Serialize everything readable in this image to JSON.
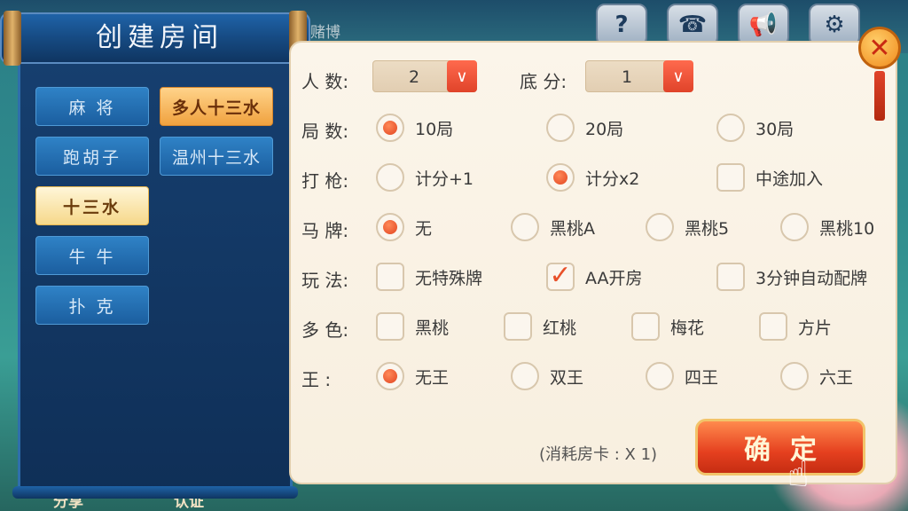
{
  "background": {
    "top_label": "赌博",
    "bottom_left_text": "分享",
    "bottom_mid_text": "认证",
    "top_icons": [
      "help-icon",
      "phone-icon",
      "megaphone-icon",
      "settings-icon"
    ]
  },
  "panel_title": "创建房间",
  "games": [
    {
      "label": "麻 将"
    },
    {
      "label": "多人十三水"
    },
    {
      "label": "跑胡子"
    },
    {
      "label": "温州十三水"
    },
    {
      "label": "十三水"
    },
    {
      "label": "牛 牛"
    },
    {
      "label": "扑 克"
    }
  ],
  "settings": {
    "players": {
      "label": "人  数:",
      "value": "2"
    },
    "base_score": {
      "label": "底  分:",
      "value": "1"
    },
    "rounds": {
      "label": "局  数:",
      "options": [
        "10局",
        "20局",
        "30局"
      ],
      "selected": 0
    },
    "gun": {
      "label": "打  枪:",
      "options": [
        "计分+1",
        "计分x2",
        "中途加入"
      ]
    },
    "horse": {
      "label": "马  牌:",
      "options": [
        "无",
        "黑桃A",
        "黑桃5",
        "黑桃10"
      ],
      "selected": 0
    },
    "play": {
      "label": "玩  法:",
      "options": [
        "无特殊牌",
        "AA开房",
        "3分钟自动配牌"
      ]
    },
    "colors": {
      "label": "多  色:",
      "options": [
        "黑桃",
        "红桃",
        "梅花",
        "方片"
      ]
    },
    "king": {
      "label": "王    :",
      "options": [
        "无王",
        "双王",
        "四王",
        "六王"
      ],
      "selected": 0
    }
  },
  "cost_text": "(消耗房卡 : X 1)",
  "confirm_label": "确定",
  "colors": {
    "accent": "#e5401f",
    "panel": "#fbf5ea",
    "sidebar": "#163f6f"
  }
}
